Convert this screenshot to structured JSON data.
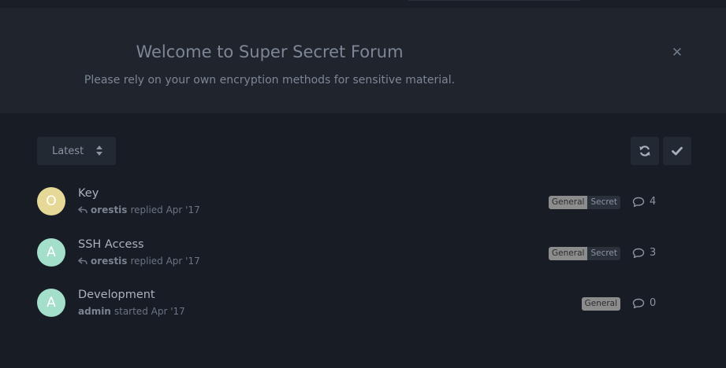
{
  "hero": {
    "title": "Welcome to Super Secret Forum",
    "subtitle": "Please rely on your own encryption methods for sensitive material.",
    "close_icon": "close-icon"
  },
  "toolbar": {
    "sort_label": "Latest",
    "refresh_icon": "refresh-icon",
    "mark_all_read_icon": "check-icon"
  },
  "discussions": [
    {
      "avatar_initial": "O",
      "avatar_color": "#e6d997",
      "title": "Key",
      "meta_icon": "reply-icon",
      "user": "orestis",
      "action": "replied Apr '17",
      "tags": [
        "General",
        "Secret"
      ],
      "reply_count": "4"
    },
    {
      "avatar_initial": "A",
      "avatar_color": "#a4dfcc",
      "title": "SSH Access",
      "meta_icon": "reply-icon",
      "user": "orestis",
      "action": "replied Apr '17",
      "tags": [
        "General",
        "Secret"
      ],
      "reply_count": "3"
    },
    {
      "avatar_initial": "A",
      "avatar_color": "#a4dfcc",
      "title": "Development",
      "meta_icon": "",
      "user": "admin",
      "action": "started Apr '17",
      "tags": [
        "General"
      ],
      "reply_count": "0"
    }
  ],
  "colors": {
    "background": "#181c24",
    "hero_background": "#1f242d",
    "tag_general": "#8c8c8c",
    "tag_secret": "#2b313b"
  }
}
